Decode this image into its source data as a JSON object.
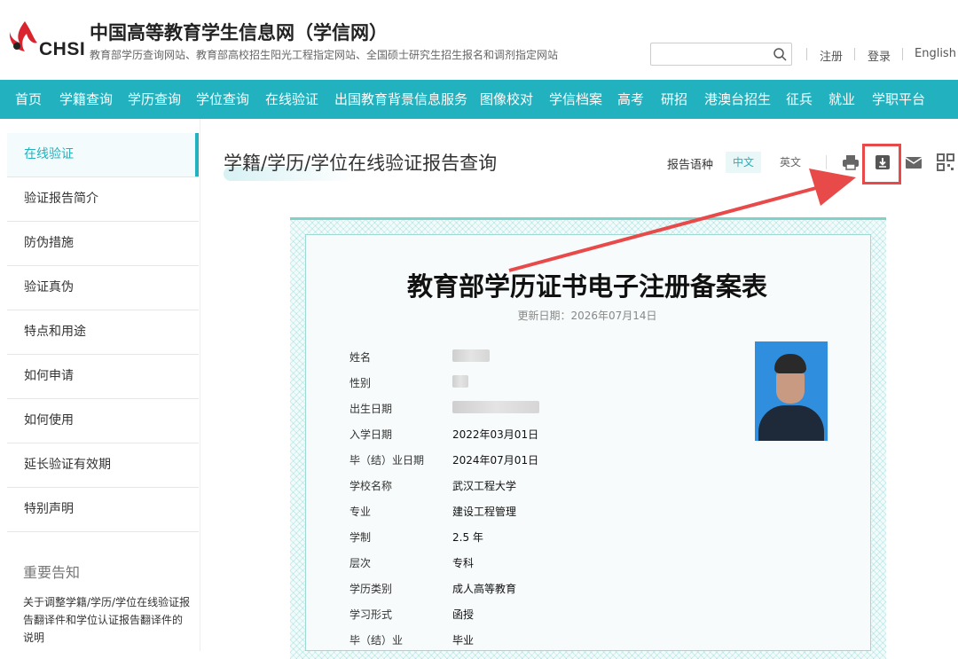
{
  "header": {
    "logo_text": "CHSI",
    "title": "中国高等教育学生信息网（学信网）",
    "subtitle": "教育部学历查询网站、教育部高校招生阳光工程指定网站、全国硕士研究生招生报名和调剂指定网站",
    "search": {
      "placeholder": "",
      "value": ""
    },
    "links": {
      "register": "注册",
      "login": "登录",
      "english": "English"
    }
  },
  "nav": {
    "items": [
      "首页",
      "学籍查询",
      "学历查询",
      "学位查询",
      "在线验证",
      "出国教育背景信息服务",
      "图像校对",
      "学信档案",
      "高考",
      "研招",
      "港澳台招生",
      "征兵",
      "就业",
      "学职平台"
    ]
  },
  "sidebar": {
    "items": [
      "在线验证",
      "验证报告简介",
      "防伪措施",
      "验证真伪",
      "特点和用途",
      "如何申请",
      "如何使用",
      "延长验证有效期",
      "特别声明"
    ],
    "notice_title": "重要告知",
    "notice_text": "关于调整学籍/学历/学位在线验证报告翻译件和学位认证报告翻译件的说明"
  },
  "main": {
    "title": "学籍/学历/学位在线验证报告查询",
    "lang_label": "报告语种",
    "lang_zh": "中文",
    "lang_en": "英文"
  },
  "certificate": {
    "title": "教育部学历证书电子注册备案表",
    "update_date": "更新日期：2026年07月14日",
    "fields": [
      {
        "label": "姓名",
        "value": ""
      },
      {
        "label": "性别",
        "value": ""
      },
      {
        "label": "出生日期",
        "value": ""
      },
      {
        "label": "入学日期",
        "value": "2022年03月01日"
      },
      {
        "label": "毕（结）业日期",
        "value": "2024年07月01日"
      },
      {
        "label": "学校名称",
        "value": "武汉工程大学"
      },
      {
        "label": "专业",
        "value": "建设工程管理"
      },
      {
        "label": "学制",
        "value": "2.5 年"
      },
      {
        "label": "层次",
        "value": "专科"
      },
      {
        "label": "学历类别",
        "value": "成人高等教育"
      },
      {
        "label": "学习形式",
        "value": "函授"
      },
      {
        "label": "毕（结）业",
        "value": "毕业"
      }
    ]
  },
  "colors": {
    "accent": "#22b1be",
    "highlight": "#e84a4a",
    "logo_red": "#d9232d"
  }
}
